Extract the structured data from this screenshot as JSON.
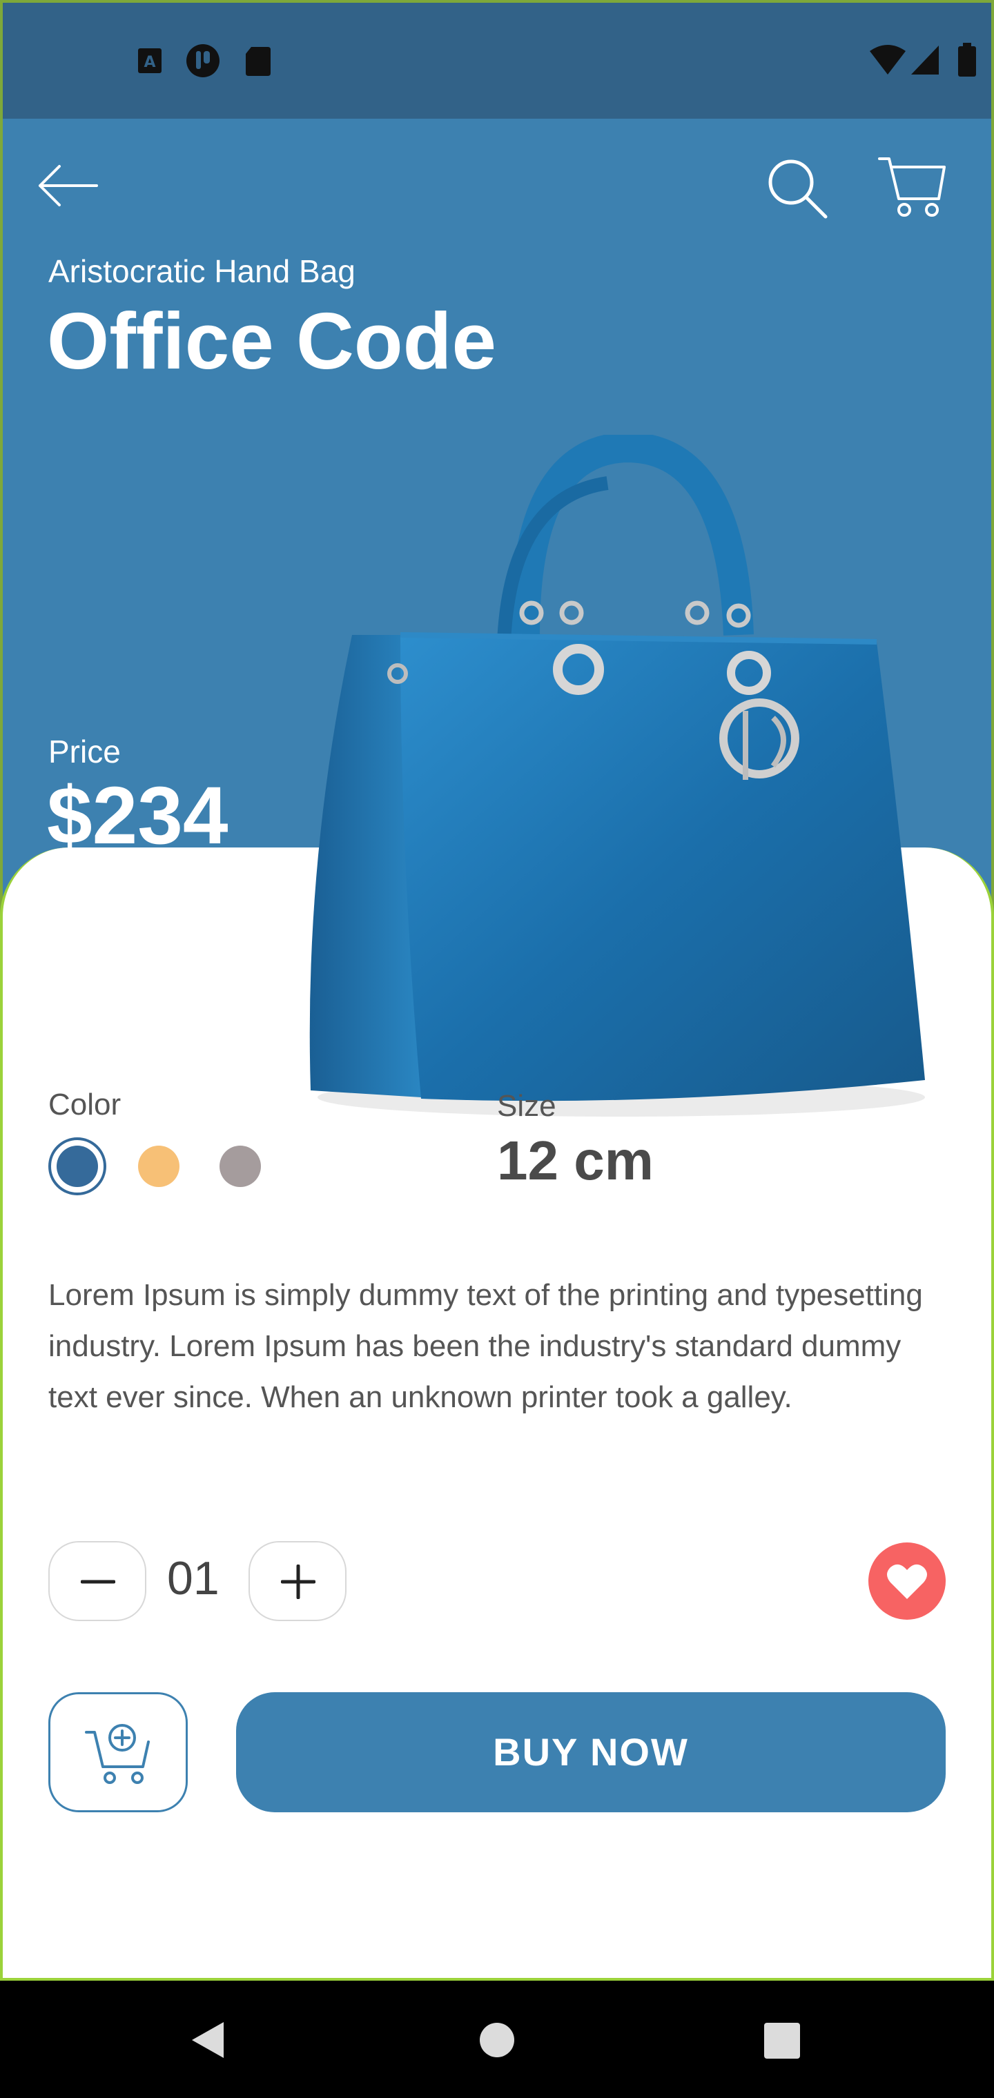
{
  "status_bar": {
    "left_icons": [
      "a-notification-icon",
      "app-notification-icon",
      "sd-card-icon"
    ],
    "right_icons": [
      "wifi-icon",
      "signal-icon",
      "battery-icon"
    ]
  },
  "header": {
    "back_icon": "arrow-left-icon",
    "search_icon": "search-icon",
    "cart_icon": "cart-icon"
  },
  "product": {
    "category": "Aristocratic Hand Bag",
    "name": "Office Code",
    "price_label": "Price",
    "price": "$234",
    "color_label": "Color",
    "colors": [
      "#356a9a",
      "#f7c076",
      "#a59c9d"
    ],
    "selected_color_index": 0,
    "size_label": "Size",
    "size": "12 cm",
    "description": "Lorem Ipsum is simply dummy text of the printing and typesetting industry. Lorem Ipsum has been the industry's standard dummy text ever since. When an unknown printer took a galley."
  },
  "quantity": {
    "value": "01"
  },
  "actions": {
    "buy_label": "BUY  NOW",
    "favorite": true
  },
  "colors": {
    "primary": "#3d81b0",
    "status_bar": "#326288",
    "favorite": "#f76363"
  },
  "nav_bar": {
    "icons": [
      "back-triangle-icon",
      "home-circle-icon",
      "recents-square-icon"
    ]
  }
}
